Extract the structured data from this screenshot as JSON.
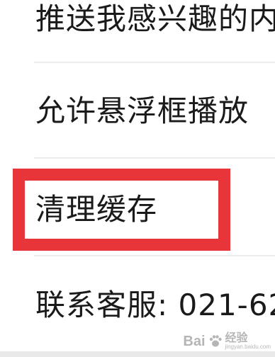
{
  "settings": {
    "items": [
      {
        "label": "推送我感兴趣的内"
      },
      {
        "label": "允许悬浮框播放"
      },
      {
        "label": "清理缓存"
      },
      {
        "label": "联系客服: 021-62"
      }
    ]
  },
  "highlight": {
    "color": "#e8353a",
    "target": "清理缓存"
  },
  "watermark": {
    "logo": "Bai",
    "suffix": "经验",
    "sub": "jingyan.baidu.com"
  }
}
